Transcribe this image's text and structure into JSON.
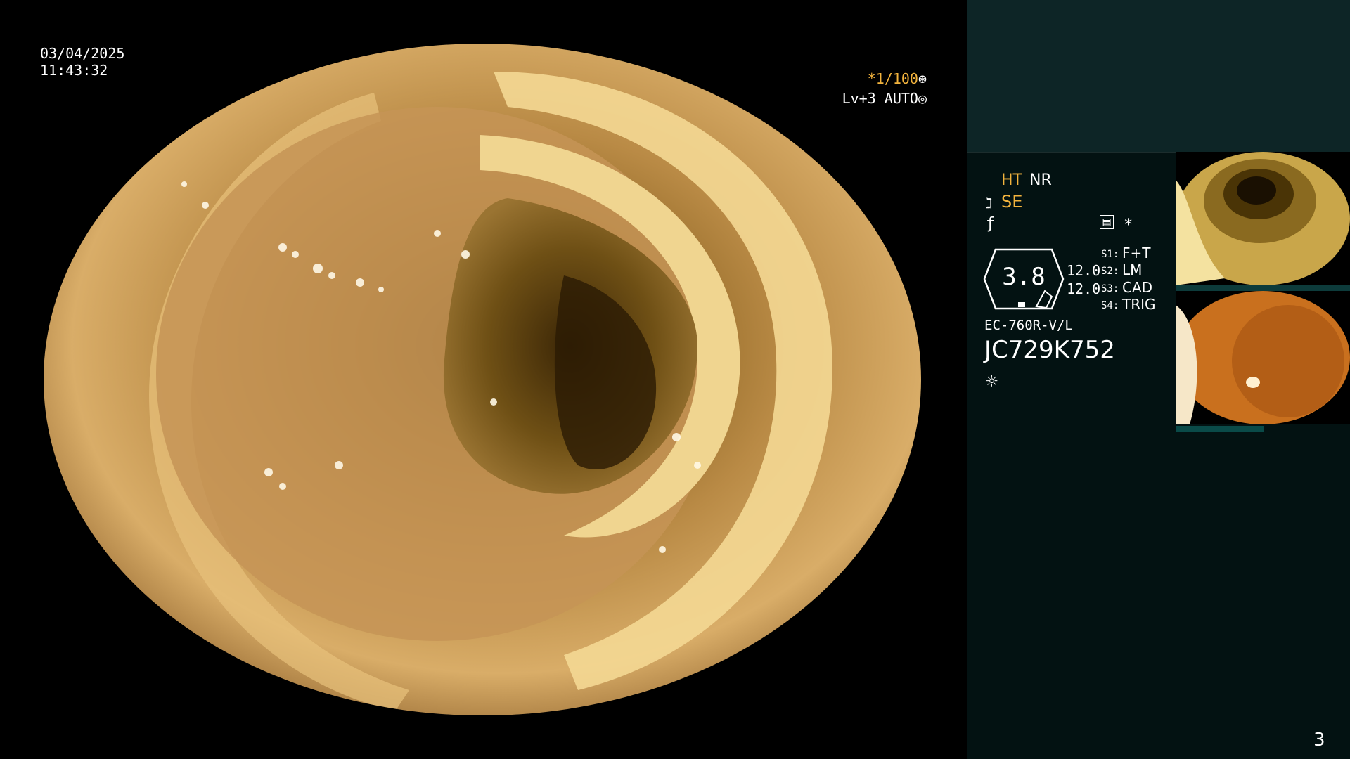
{
  "overlay": {
    "date": "03/04/2025",
    "time": "11:43:32",
    "shutter": "*1/100",
    "shutter_icon": "⊛",
    "level": "Lv+3 AUTO",
    "level_icon": "◎"
  },
  "panel": {
    "ht": "HT",
    "nr": "NR",
    "se_icon": "ℷ",
    "se": "SE",
    "f_icon": "ƒ",
    "memory_icon": "▤",
    "star": "*",
    "gauge_value": "3.8",
    "value_1": "12.0",
    "value_2": "12.0",
    "switches": [
      {
        "label": "S1:",
        "value": "F+T"
      },
      {
        "label": "S2:",
        "value": "LM"
      },
      {
        "label": "S3:",
        "value": "CAD"
      },
      {
        "label": "S4:",
        "value": "TRIG"
      }
    ],
    "scope_model": "EC-760R-V/L",
    "serial": "JC729K752",
    "light_icon": "☼",
    "page_number": "3"
  },
  "colors": {
    "accent_yellow": "#f2b33d",
    "panel_bg": "#031212",
    "teal_box": "#0d2526"
  }
}
